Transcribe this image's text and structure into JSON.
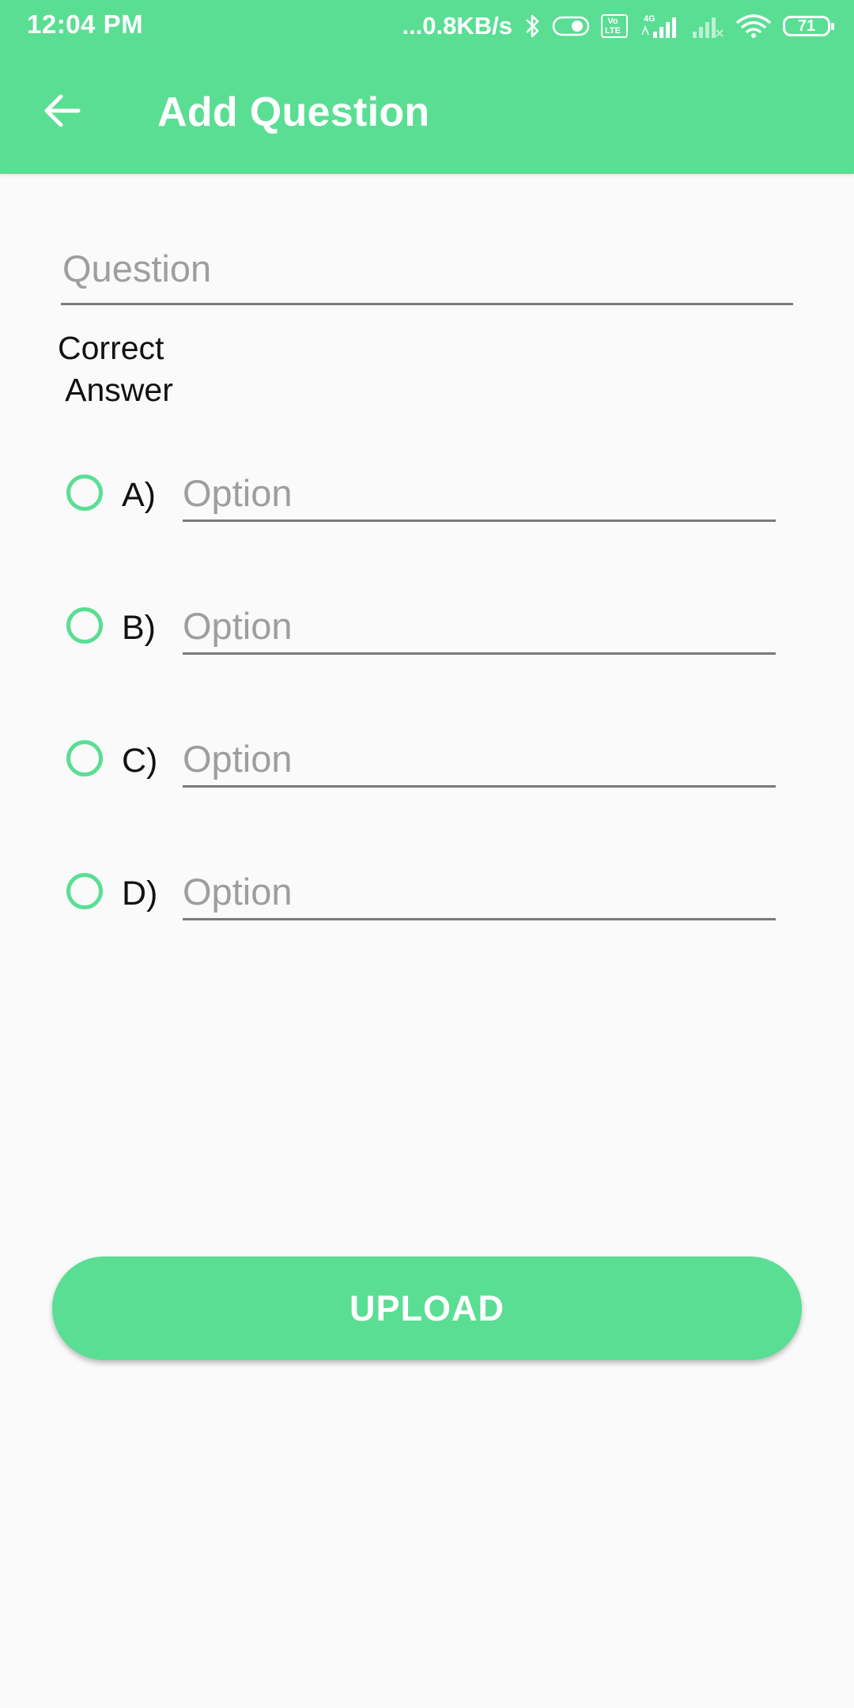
{
  "status_bar": {
    "time": "12:04 PM",
    "network_speed": "...0.8KB/s",
    "volte_label": "Vo\nLTE",
    "network_type": "4G",
    "battery_level": "71",
    "icons": [
      "bluetooth-icon",
      "toggle-icon",
      "volte-icon",
      "signal-icon",
      "signal-icon",
      "wifi-icon",
      "battery-icon"
    ]
  },
  "app_bar": {
    "title": "Add Question",
    "back_icon": "arrow-left-icon"
  },
  "form": {
    "question_placeholder": "Question",
    "correct_answer_label_line1": "Correct",
    "correct_answer_label_line2": " Answer",
    "options": [
      {
        "letter": "A)",
        "placeholder": "Option"
      },
      {
        "letter": "B)",
        "placeholder": "Option"
      },
      {
        "letter": "C)",
        "placeholder": "Option"
      },
      {
        "letter": "D)",
        "placeholder": "Option"
      }
    ],
    "upload_label": "UPLOAD"
  },
  "colors": {
    "accent": "#5ade93",
    "background": "#fafafa",
    "underline": "#7a7a7a",
    "placeholder": "#9e9e9e"
  }
}
